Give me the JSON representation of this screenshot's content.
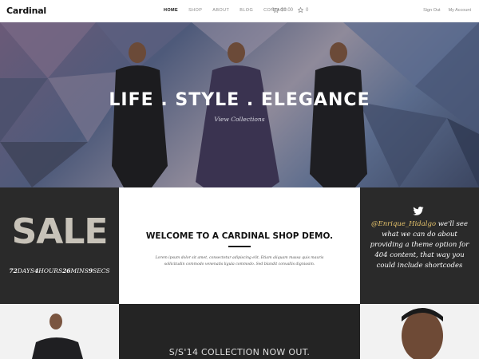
{
  "brand": {
    "logo": "Cardinal"
  },
  "nav": {
    "items": [
      {
        "label": "HOME",
        "active": true
      },
      {
        "label": "SHOP",
        "active": false
      },
      {
        "label": "ABOUT",
        "active": false
      },
      {
        "label": "BLOG",
        "active": false
      },
      {
        "label": "CONTACT",
        "active": false
      }
    ],
    "cart_total": "$0.00",
    "wishlist_count": "0",
    "sign_out": "Sign Out",
    "my_account": "My Account"
  },
  "hero": {
    "title": "LIFE . STYLE . ELEGANCE",
    "link": "View Collections"
  },
  "sale": {
    "label": "SALE",
    "countdown": {
      "days": "72",
      "days_unit": "DAYS",
      "hours": "4",
      "hours_unit": "HOURS",
      "mins": "26",
      "mins_unit": "MINS",
      "secs": "9",
      "secs_unit": "SECS"
    }
  },
  "welcome": {
    "title": "WELCOME TO A CARDINAL SHOP DEMO.",
    "body": "Lorem ipsum dolor sit amet, consectetur adipiscing elit. Etiam aliquam massa quis mauris sollicitudin commodo venenatis ligula commodo. Sed blandit convallis dignissim."
  },
  "tweet": {
    "handle": "@Enrique_Hidalgo",
    "text": " we'll see what we can do about providing a theme option for 404 content, that way you could include shortcodes"
  },
  "collection": {
    "title": "S/S'14 COLLECTION NOW OUT."
  },
  "colors": {
    "dark_tile": "#2a2a2a",
    "accent_handle": "#e6c36b"
  }
}
